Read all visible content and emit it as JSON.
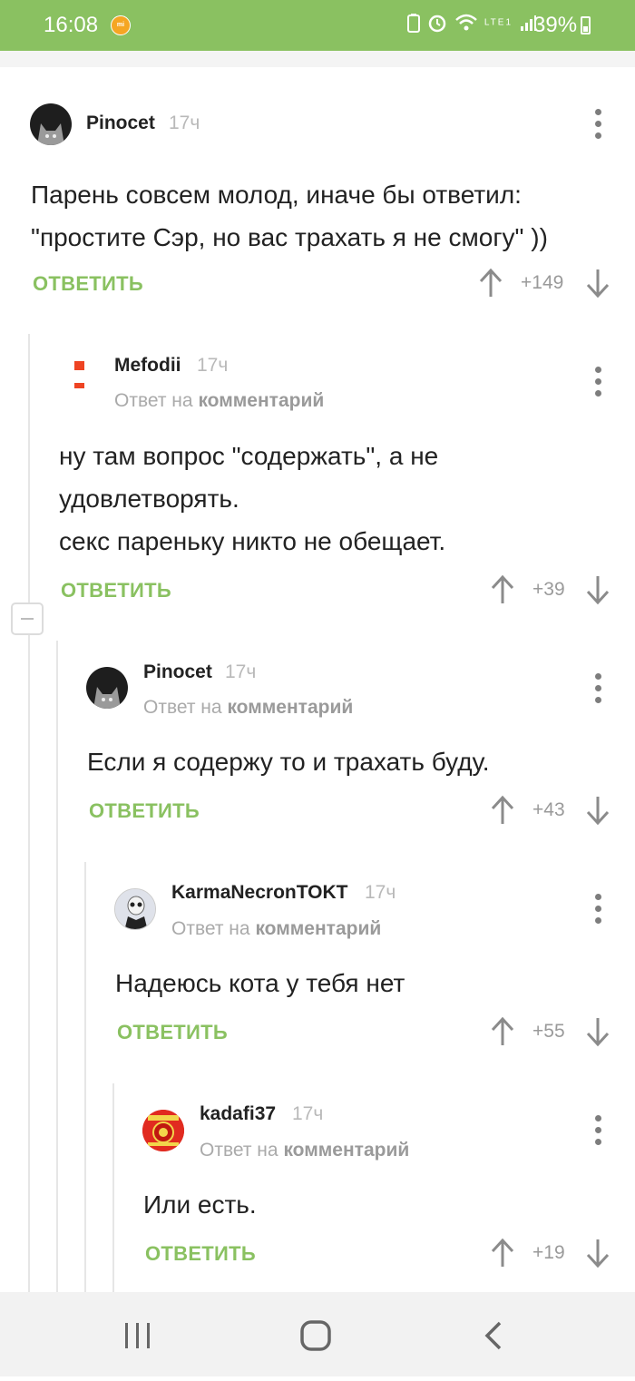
{
  "status_bar": {
    "time": "16:08",
    "battery": "39%",
    "network": "LTE1"
  },
  "colors": {
    "accent": "#8ac161",
    "mefodii_brand": "#ee4423"
  },
  "common": {
    "reply_prefix": "Ответ на",
    "reply_target": "комментарий",
    "reply_button": "ОТВЕТИТЬ"
  },
  "comments": [
    {
      "author": "Pinocet",
      "time": "17ч",
      "is_reply": false,
      "lines": [
        "Парень совсем молод, иначе бы ответил:",
        "\"простите Сэр, но вас трахать я не смогу\" ))"
      ],
      "rating": "+149"
    },
    {
      "author": "Mefodii",
      "time": "17ч",
      "is_reply": true,
      "lines": [
        "ну там вопрос \"содержать\", а не",
        "удовлетворять.",
        "секс пареньку никто не обещает."
      ],
      "rating": "+39"
    },
    {
      "author": "Pinocet",
      "time": "17ч",
      "is_reply": true,
      "lines": [
        "Если я содержу то и трахать буду."
      ],
      "rating": "+43"
    },
    {
      "author": "KarmaNecronTOKT",
      "time": "17ч",
      "is_reply": true,
      "lines": [
        "Надеюсь кота у тебя нет"
      ],
      "rating": "+55"
    },
    {
      "author": "kadafi37",
      "time": "17ч",
      "is_reply": true,
      "lines": [
        "Или есть."
      ],
      "rating": "+19"
    }
  ],
  "nav_bar": {
    "items": [
      "recent-apps-icon",
      "home-icon",
      "back-icon"
    ]
  }
}
